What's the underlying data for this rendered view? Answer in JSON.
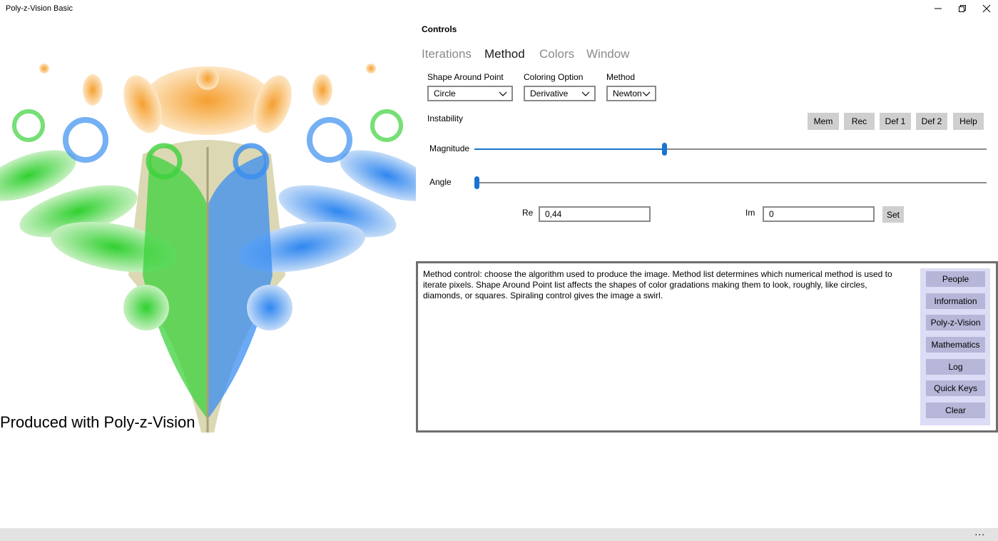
{
  "window": {
    "title": "Poly-z-Vision Basic"
  },
  "image": {
    "watermark": "Produced with Poly-z-Vision"
  },
  "controls": {
    "title": "Controls",
    "tabs": [
      {
        "label": "Iterations",
        "active": false
      },
      {
        "label": "Method",
        "active": true
      },
      {
        "label": "Colors",
        "active": false
      },
      {
        "label": "Window",
        "active": false
      }
    ],
    "shape": {
      "label": "Shape Around Point",
      "value": "Circle"
    },
    "coloring": {
      "label": "Coloring Option",
      "value": "Derivative"
    },
    "method": {
      "label": "Method",
      "value": "Newton"
    },
    "instability_label": "Instability",
    "buttons": {
      "mem": "Mem",
      "rec": "Rec",
      "def1": "Def 1",
      "def2": "Def 2",
      "help": "Help"
    },
    "magnitude": {
      "label": "Magnitude",
      "fraction": 0.37
    },
    "angle": {
      "label": "Angle",
      "fraction": 0.0
    },
    "re": {
      "label": "Re",
      "value": "0,44"
    },
    "im": {
      "label": "Im",
      "value": "0"
    },
    "set_label": "Set"
  },
  "info": {
    "text": "Method control: choose the algorithm used to produce the image. Method list determines which numerical method is used to iterate pixels. Shape Around Point list affects the shapes of color gradations making them to look, roughly, like circles, diamonds, or squares. Spiraling control gives the image a swirl.",
    "buttons": [
      "People",
      "Information",
      "Poly-z-Vision",
      "Mathematics",
      "Log",
      "Quick Keys",
      "Clear"
    ]
  },
  "statusbar": {
    "more": "..."
  },
  "colors": {
    "accent": "#1874d0",
    "orange": "#f5a030",
    "green": "#3cd23c",
    "blue": "#3a8ef0",
    "cream": "#dcd8b4"
  }
}
